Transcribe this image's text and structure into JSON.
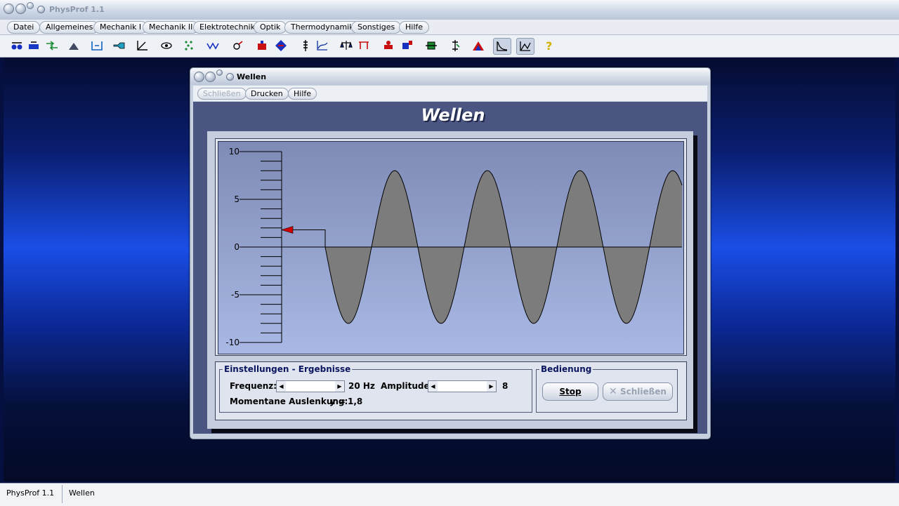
{
  "app": {
    "title": "PhysProf 1.1"
  },
  "menu": [
    "Datei",
    "Allgemeines",
    "Mechanik I",
    "Mechanik II",
    "Elektrotechnik",
    "Optik",
    "Thermodynamik",
    "Sonstiges",
    "Hilfe"
  ],
  "toolbar": {
    "icons": [
      "balls-icon",
      "vehicle-icon",
      "exchange-icon",
      "ramp-icon",
      "scale-icon",
      "pipe-icon",
      "angle-icon",
      "eye-icon",
      "dots-icon",
      "zigzag-icon",
      "atom-icon",
      "magnet-icon",
      "charge-icon",
      "spring-icon",
      "curve-icon",
      "balance-icon",
      "lever-icon",
      "cart-icon",
      "vessel-icon",
      "coil-icon",
      "lamp-icon",
      "spectrum-icon",
      "decay-icon",
      "graph-icon",
      "help-icon"
    ],
    "pressed": [
      "decay-icon",
      "graph-icon"
    ]
  },
  "window": {
    "title": "Wellen",
    "menu": [
      {
        "label": "Schließen",
        "disabled": true
      },
      {
        "label": "Drucken",
        "disabled": false
      },
      {
        "label": "Hilfe",
        "disabled": false
      }
    ],
    "heading": "Wellen"
  },
  "chart_data": {
    "type": "line",
    "ylim": [
      -10,
      10
    ],
    "yticks": [
      "10",
      "5",
      "0",
      "-5",
      "-10"
    ],
    "amplitude": 8,
    "periods_visible": 3.85,
    "current_marker": 1.8,
    "fill_color": "#7c7c7c"
  },
  "settings": {
    "legend": "Einstellungen - Ergebnisse",
    "freq_label": "Frequenz:",
    "freq_value": "20 Hz",
    "amp_label": "Amplitude:",
    "amp_value": "8",
    "result_label": "Momentane Auslenkung:",
    "result_var": "y =",
    "result_value": "1,8"
  },
  "operation": {
    "legend": "Bedienung",
    "stop": "Stop",
    "close": "Schließen"
  },
  "status": {
    "app": "PhysProf 1.1",
    "window": "Wellen"
  },
  "colors": {
    "legend": "#0a1560",
    "marker": "#d00000"
  }
}
